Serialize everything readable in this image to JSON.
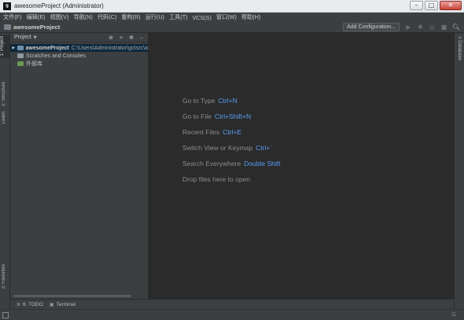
{
  "window": {
    "icon_label": "IJ",
    "title": "awesomeProject (Administrator)",
    "minimize": "–",
    "maximize": "□",
    "close": "✕"
  },
  "menu": [
    "文件(F)",
    "编辑(E)",
    "视图(V)",
    "导航(N)",
    "代码(C)",
    "重构(R)",
    "运行(U)",
    "工具(T)",
    "VCS(S)",
    "窗口(W)",
    "帮助(H)"
  ],
  "toolbar": {
    "project_name": "awesomeProject",
    "add_configuration": "Add Configuration...",
    "icons": [
      "run-icon",
      "debug-icon",
      "coverage-icon",
      "stop-icon",
      "search-icon"
    ]
  },
  "left_tabs": {
    "project": "1: Project",
    "structure": "2: Structure",
    "learn": "Learn",
    "favorites": "2: Favorites"
  },
  "right_tabs": {
    "database": "Database"
  },
  "project_panel": {
    "title": "Project",
    "tree": [
      {
        "name": "awesomeProject",
        "path": "C:\\Users\\Administrator\\go\\src\\a",
        "selected": true
      },
      {
        "name": "Scratches and Consoles"
      },
      {
        "name": "外部库"
      }
    ]
  },
  "editor_hints": [
    {
      "label": "Go to Type",
      "shortcut": "Ctrl+N"
    },
    {
      "label": "Go to File",
      "shortcut": "Ctrl+Shift+N"
    },
    {
      "label": "Recent Files",
      "shortcut": "Ctrl+E"
    },
    {
      "label": "Switch View or Keymap",
      "shortcut": "Ctrl+`"
    },
    {
      "label": "Search Everywhere",
      "shortcut": "Double Shift"
    },
    {
      "label": "Drop files here to open",
      "shortcut": ""
    }
  ],
  "bottom_tabs": {
    "todo": "6: TODO",
    "terminal": "Terminal"
  },
  "colors": {
    "editor_bg": "#2b2b2b",
    "panel_bg": "#3c3f41",
    "shortcut": "#589df6",
    "selection": "#0d293e"
  }
}
